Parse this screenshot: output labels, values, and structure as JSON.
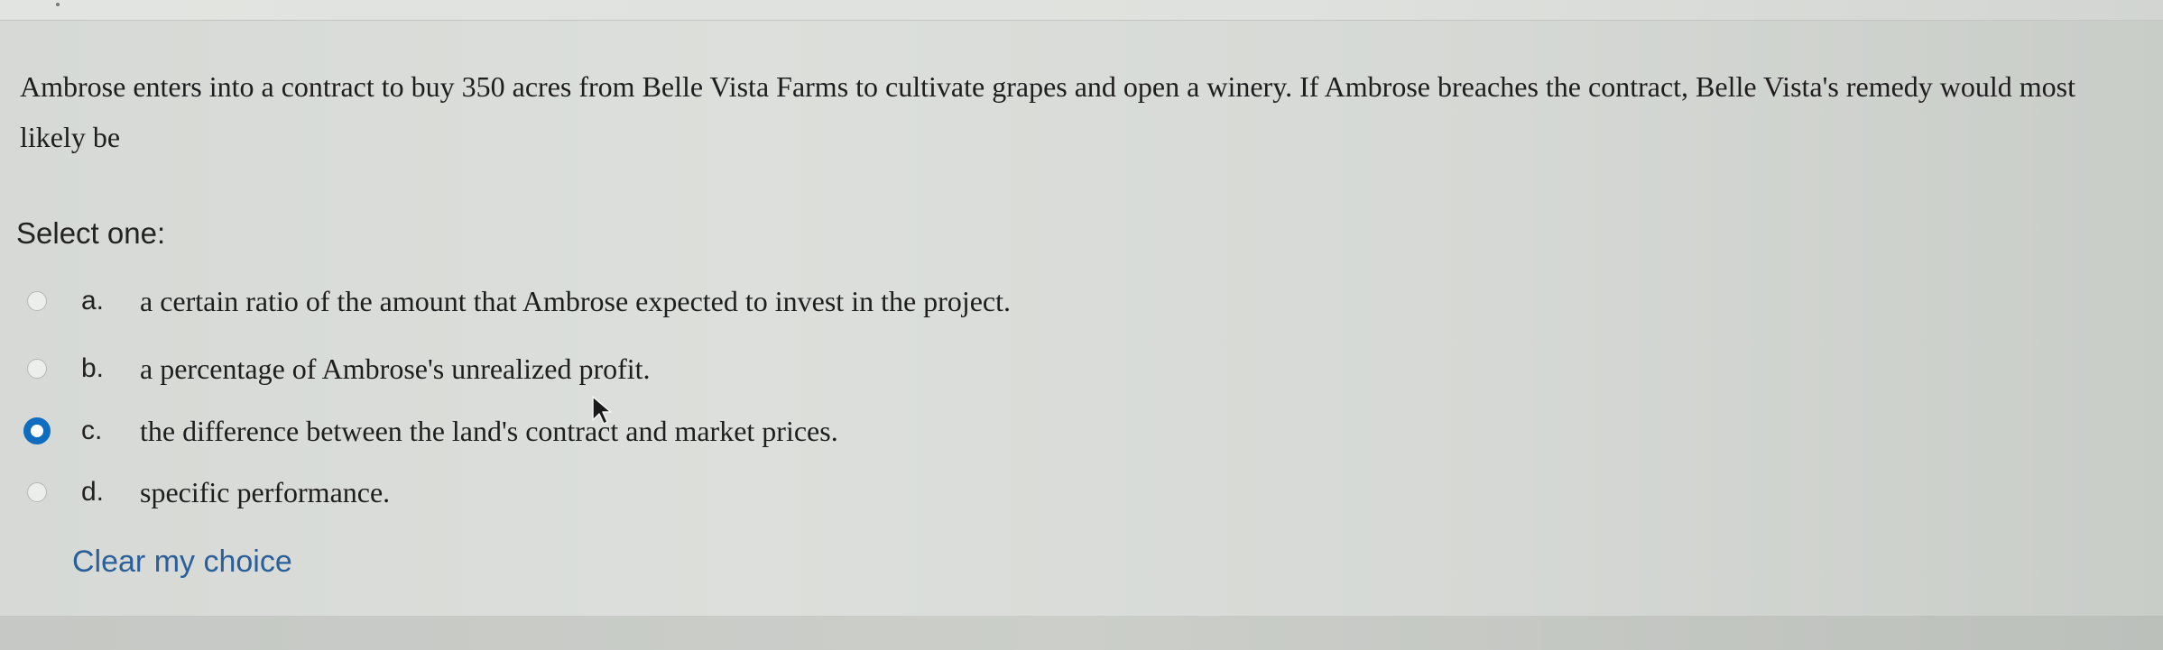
{
  "question": {
    "text": "Ambrose enters into a contract to buy 350 acres from Belle Vista Farms to cultivate grapes and open a winery. If Ambrose breaches the contract, Belle Vista's remedy would most likely be"
  },
  "prompt": "Select one:",
  "options": [
    {
      "letter": "a.",
      "text": "a certain ratio of the amount that Ambrose expected to invest in the project.",
      "selected": false
    },
    {
      "letter": "b.",
      "text": "a percentage of Ambrose's unrealized profit.",
      "selected": false
    },
    {
      "letter": "c.",
      "text": "the difference between the land's contract and market prices.",
      "selected": true
    },
    {
      "letter": "d.",
      "text": "specific performance.",
      "selected": false
    }
  ],
  "clear_choice_label": "Clear my choice",
  "colors": {
    "accent": "#0f6cbf",
    "link": "#2a5f99"
  },
  "icons": {
    "cursor": "mouse-pointer-icon"
  }
}
